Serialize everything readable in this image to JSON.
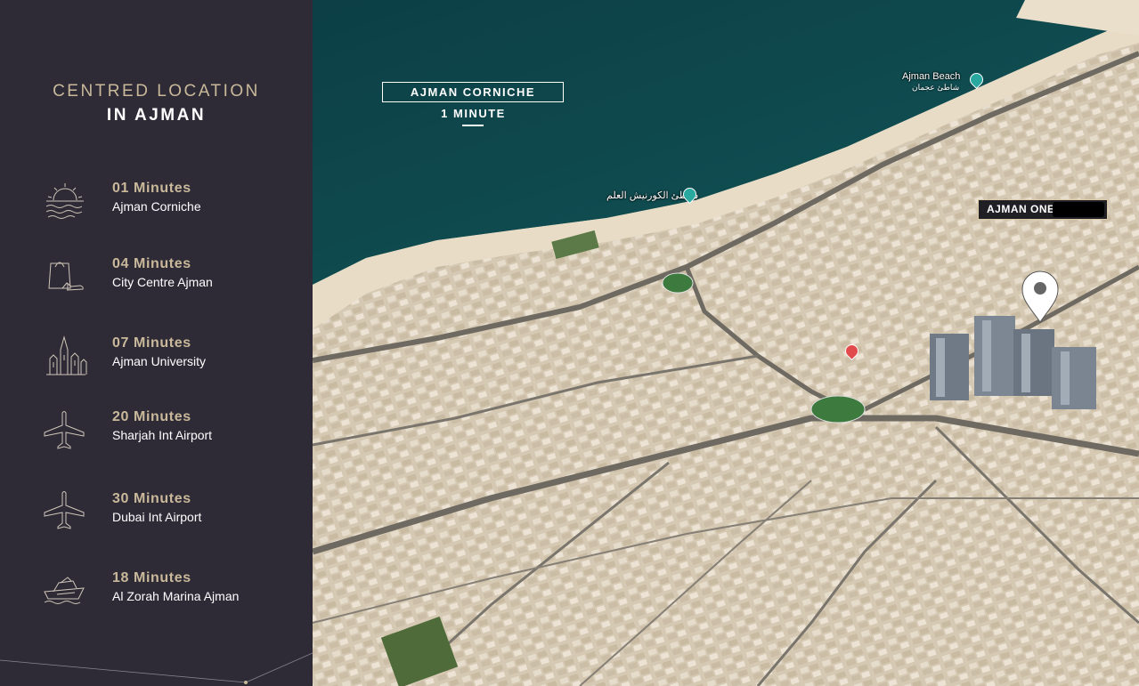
{
  "panel": {
    "title_line1": "CENTRED LOCATION",
    "title_line2": "IN AJMAN",
    "items": [
      {
        "minutes": "01 Minutes",
        "place": "Ajman Corniche",
        "icon": "sun-over-water-icon"
      },
      {
        "minutes": "04 Minutes",
        "place": "City Centre Ajman",
        "icon": "shopping-bag-icon"
      },
      {
        "minutes": "07 Minutes",
        "place": "Ajman University",
        "icon": "university-building-icon"
      },
      {
        "minutes": "20 Minutes",
        "place": "Sharjah Int Airport",
        "icon": "airplane-icon"
      },
      {
        "minutes": "30 Minutes",
        "place": "Dubai Int Airport",
        "icon": "airplane-icon"
      },
      {
        "minutes": "18 Minutes",
        "place": "Al Zorah Marina Ajman",
        "icon": "yacht-icon"
      }
    ]
  },
  "map": {
    "corniche_label": "AJMAN CORNICHE",
    "corniche_time": "1 MINUTE",
    "poi_beach": "Ajman Beach",
    "poi_beach_ar": "شاطئ عجمان",
    "poi_flag_beach_ar": "شاطئ الكورنيش العلم",
    "project_label": "AJMAN ONE"
  },
  "colors": {
    "panel_bg": "#2e2b37",
    "accent_gold": "#c9b99a",
    "sea": "#0f4a4f",
    "pin_teal": "#29a8a0",
    "pin_red": "#e24b4b"
  }
}
